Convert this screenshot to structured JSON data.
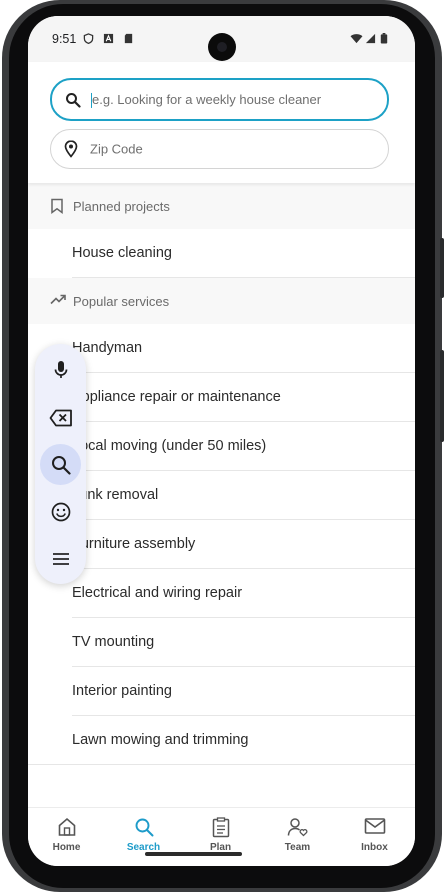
{
  "status": {
    "time": "9:51"
  },
  "search": {
    "service_placeholder": "e.g. Looking for a weekly house cleaner",
    "zip_placeholder": "Zip Code"
  },
  "planned": {
    "title": "Planned projects",
    "items": [
      "House cleaning"
    ]
  },
  "popular": {
    "title": "Popular services",
    "items": [
      "Handyman",
      "Appliance repair or maintenance",
      "Local moving (under 50 miles)",
      "Junk removal",
      "Furniture assembly",
      "Electrical and wiring repair",
      "TV mounting",
      "Interior painting",
      "Lawn mowing and trimming"
    ]
  },
  "keyboard_toolbar": {
    "buttons": [
      "microphone-icon",
      "backspace-icon",
      "search-icon",
      "emoji-icon",
      "menu-icon"
    ],
    "selected": "search-icon"
  },
  "bottom_nav": {
    "items": [
      {
        "label": "Home",
        "icon": "home-icon"
      },
      {
        "label": "Search",
        "icon": "search-icon"
      },
      {
        "label": "Plan",
        "icon": "clipboard-icon"
      },
      {
        "label": "Team",
        "icon": "team-icon"
      },
      {
        "label": "Inbox",
        "icon": "inbox-icon"
      }
    ],
    "active": "Search"
  },
  "colors": {
    "accent": "#1d9bc9",
    "field_active_border": "#1da1c6",
    "fab_selected": "#d4dcf7"
  }
}
